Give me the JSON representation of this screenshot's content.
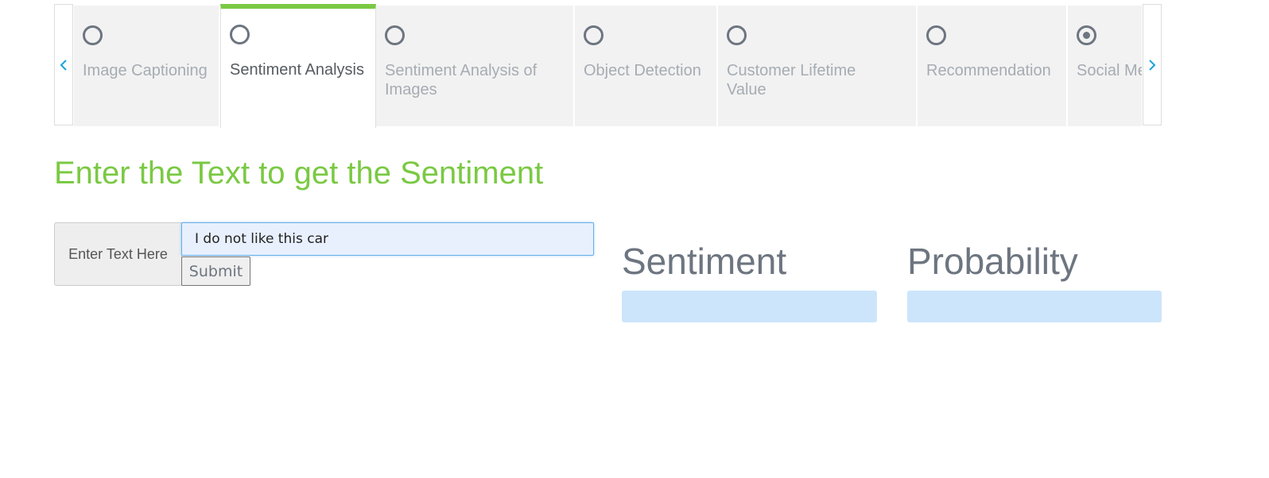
{
  "tabs": [
    {
      "label": "Image Captioning",
      "active": false,
      "selected": false
    },
    {
      "label": "Sentiment Analysis",
      "active": true,
      "selected": false
    },
    {
      "label": "Sentiment Analysis of Images",
      "active": false,
      "selected": false
    },
    {
      "label": "Object Detection",
      "active": false,
      "selected": false
    },
    {
      "label": "Customer Lifetime Value",
      "active": false,
      "selected": false
    },
    {
      "label": "Recommendation",
      "active": false,
      "selected": false
    },
    {
      "label": "Social Media",
      "active": false,
      "selected": true
    }
  ],
  "nav": {
    "prev_icon": "chevron-left-icon",
    "next_icon": "chevron-right-icon"
  },
  "main": {
    "heading": "Enter the Text to get the Sentiment",
    "input_label": "Enter Text Here",
    "input_value": "I do not like this car",
    "submit_label": "Submit"
  },
  "results": {
    "sentiment_title": "Sentiment",
    "sentiment_value": "",
    "probability_title": "Probability",
    "probability_value": ""
  },
  "colors": {
    "accent": "#7ac943",
    "nav_arrow": "#1aa3df",
    "result_box": "#cce5fb"
  }
}
